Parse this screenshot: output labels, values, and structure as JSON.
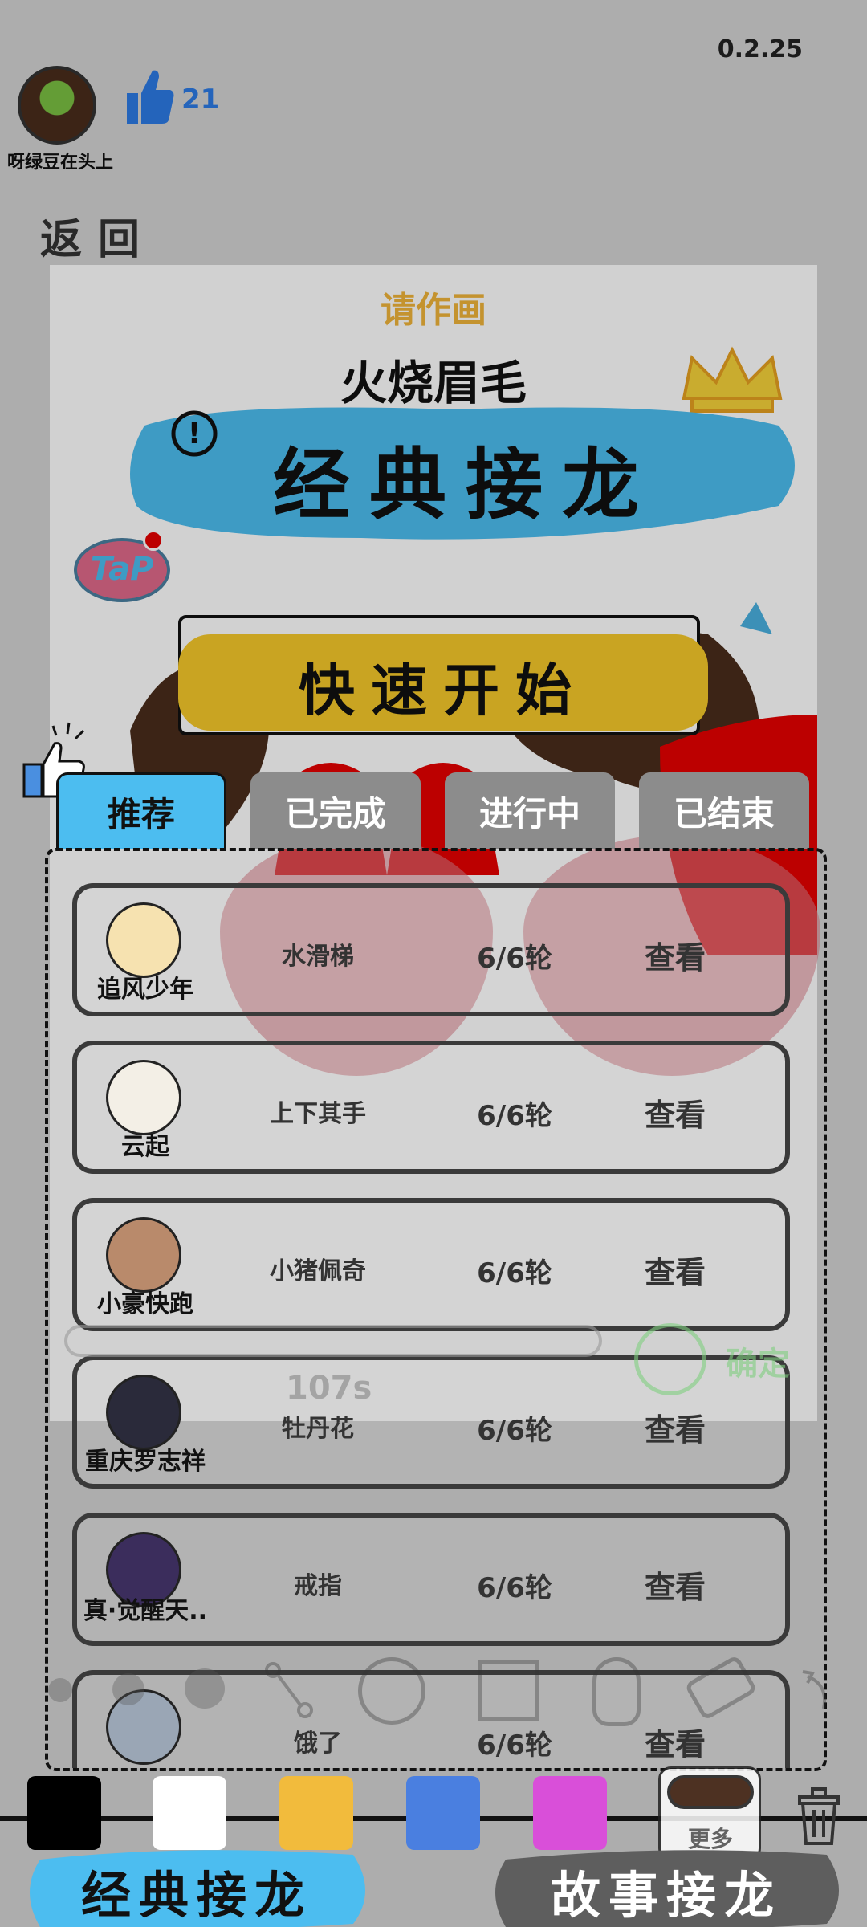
{
  "header": {
    "version": "0.2.25",
    "username": "呀绿豆在头上",
    "like_count": "21",
    "back_label": "返回"
  },
  "canvas": {
    "prompt_hint": "请作画",
    "prompt_word": "火烧眉毛",
    "banner_label": "经典接龙",
    "tap_label": "TaP",
    "quick_start_label": "快速开始"
  },
  "tabs": [
    {
      "label": "推荐",
      "active": true
    },
    {
      "label": "已完成",
      "active": false
    },
    {
      "label": "进行中",
      "active": false
    },
    {
      "label": "已结束",
      "active": false
    }
  ],
  "rows": [
    {
      "name": "追风少年",
      "word": "水滑梯",
      "rounds": "6/6轮",
      "action": "查看",
      "avatar_color": "#f6e2b0"
    },
    {
      "name": "云起",
      "word": "上下其手",
      "rounds": "6/6轮",
      "action": "查看",
      "avatar_color": "#f3efe6"
    },
    {
      "name": "小豪快跑",
      "word": "小猪佩奇",
      "rounds": "6/6轮",
      "action": "查看",
      "avatar_color": "#b98a6b"
    },
    {
      "name": "重庆罗志祥",
      "word": "牡丹花",
      "rounds": "6/6轮",
      "action": "查看",
      "avatar_color": "#2a2a3a"
    },
    {
      "name": "真·觉醒天..",
      "word": "戒指",
      "rounds": "6/6轮",
      "action": "查看",
      "avatar_color": "#3b2d5c"
    },
    {
      "name": "",
      "word": "饿了",
      "rounds": "6/6轮",
      "action": "查看",
      "avatar_color": "#9aa6b5"
    }
  ],
  "overlay": {
    "timer": "107s",
    "confirm_label": "确定"
  },
  "palette": {
    "colors": [
      "#000000",
      "#ffffff",
      "#f2bb3c",
      "#4a7fe0",
      "#d94fd9"
    ],
    "more_label": "更多"
  },
  "modes": {
    "classic": "经典接龙",
    "story": "故事接龙"
  },
  "accent_colors": {
    "like_blue": "#2d7be5",
    "tab_active": "#4cbdf0",
    "tab_inactive": "#8c8c8c",
    "confirm_green": "#7fce7f"
  }
}
